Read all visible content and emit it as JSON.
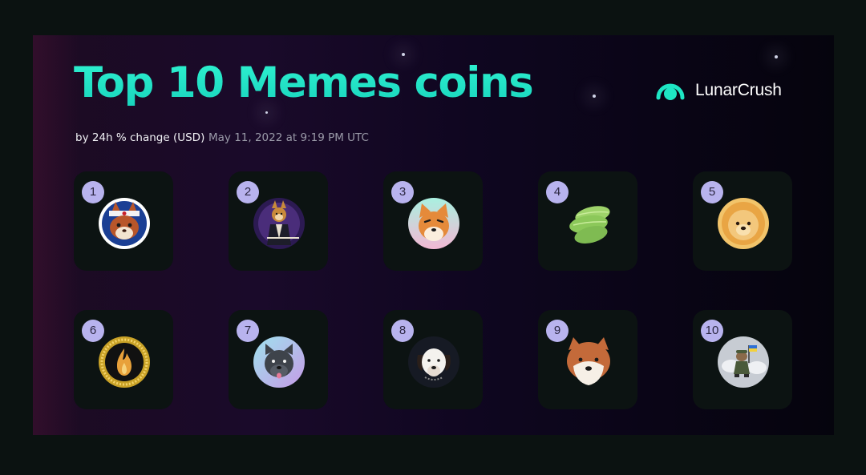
{
  "header": {
    "title": "Top 10 Memes coins",
    "subtitle": "by 24h % change (USD)",
    "timestamp": "May 11, 2022 at 9:19 PM UTC"
  },
  "brand": {
    "name": "LunarCrush",
    "icon": "lunarcrush-logo-icon",
    "accent": "#1ee6c4"
  },
  "coins": [
    {
      "rank": "1",
      "icon": "red-fox-ninja-coin-icon"
    },
    {
      "rank": "2",
      "icon": "samurai-shiba-coin-icon"
    },
    {
      "rank": "3",
      "icon": "shiba-dog-face-coin-icon"
    },
    {
      "rank": "4",
      "icon": "green-leaves-coin-icon"
    },
    {
      "rank": "5",
      "icon": "chow-chow-dog-coin-icon"
    },
    {
      "rank": "6",
      "icon": "gold-flame-coin-icon"
    },
    {
      "rank": "7",
      "icon": "pitbull-dog-coin-icon"
    },
    {
      "rank": "8",
      "icon": "white-dog-face-coin-icon"
    },
    {
      "rank": "9",
      "icon": "akita-dog-face-coin-icon"
    },
    {
      "rank": "10",
      "icon": "soldier-dog-flag-coin-icon"
    }
  ],
  "colors": {
    "rank_badge": "#b8b3ee",
    "tile_background": "#0c1312",
    "frame_background": "#0b1211"
  }
}
